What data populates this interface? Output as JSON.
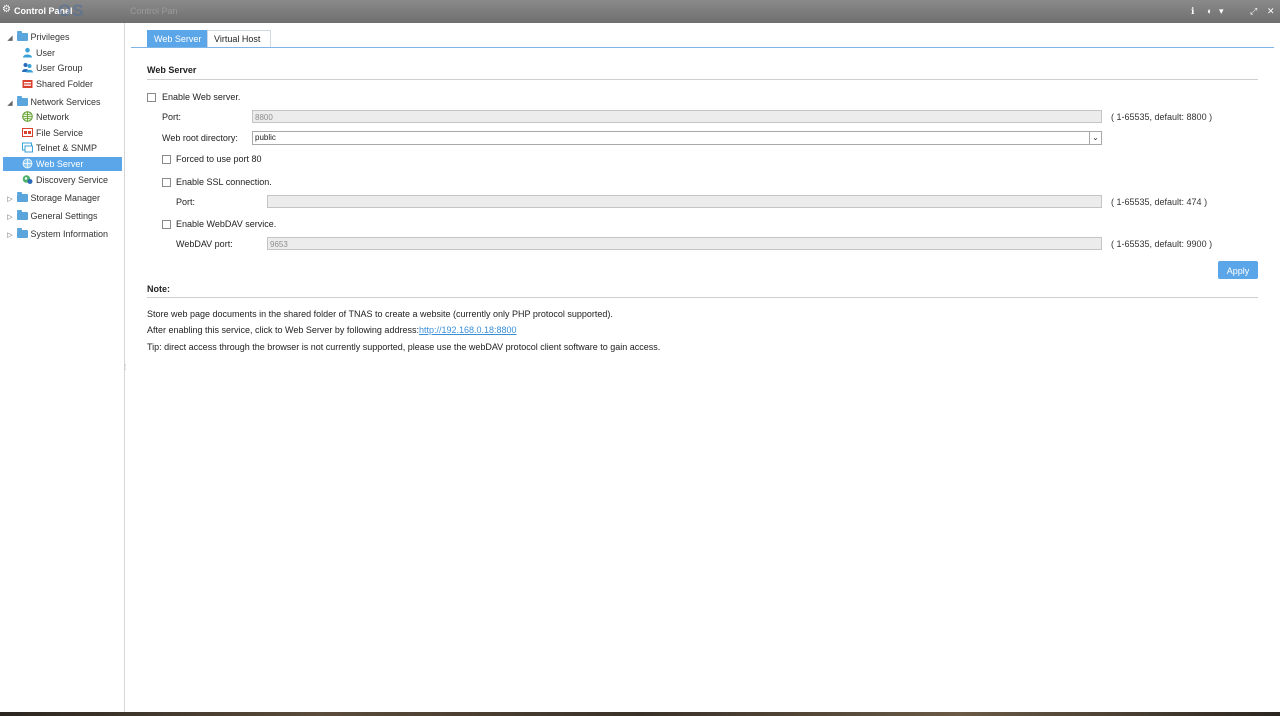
{
  "window": {
    "title": "Control Panel",
    "ghost_logo": "OS",
    "ghost_tab": "Control Pan",
    "controls": [
      "ℹ",
      "◐",
      "▾",
      "⤢",
      "✕"
    ]
  },
  "sidebar": {
    "groups": [
      {
        "label": "Privileges",
        "expanded": true,
        "items": [
          {
            "label": "User",
            "icon": "user-icon"
          },
          {
            "label": "User Group",
            "icon": "user-group-icon"
          },
          {
            "label": "Shared Folder",
            "icon": "shared-folder-icon"
          }
        ]
      },
      {
        "label": "Network Services",
        "expanded": true,
        "items": [
          {
            "label": "Network",
            "icon": "globe-icon"
          },
          {
            "label": "File Service",
            "icon": "file-service-icon"
          },
          {
            "label": "Telnet & SNMP",
            "icon": "terminal-icon"
          },
          {
            "label": "Web Server",
            "icon": "web-server-icon",
            "selected": true
          },
          {
            "label": "Discovery Service",
            "icon": "discovery-icon"
          }
        ]
      },
      {
        "label": "Storage Manager",
        "expanded": false
      },
      {
        "label": "General Settings",
        "expanded": false
      },
      {
        "label": "System Information",
        "expanded": false
      }
    ]
  },
  "tabs": [
    {
      "label": "Web Server",
      "active": true
    },
    {
      "label": "Virtual Host",
      "active": false
    }
  ],
  "web_server": {
    "section_title": "Web Server",
    "enable_label": "Enable Web server.",
    "port_label": "Port:",
    "port_value": "8800",
    "port_hint": "( 1-65535, default: 8800 )",
    "root_label": "Web root directory:",
    "root_value": "public",
    "forced_label": "Forced to use port 80",
    "ssl_label": "Enable SSL connection.",
    "ssl_port_label": "Port:",
    "ssl_port_value": "",
    "ssl_port_hint": "( 1-65535, default: 474 )",
    "webdav_label": "Enable WebDAV service.",
    "webdav_port_label": "WebDAV port:",
    "webdav_port_value": "9653",
    "webdav_port_hint": "( 1-65535, default: 9900 )",
    "apply_label": "Apply"
  },
  "note": {
    "title": "Note:",
    "line1": "Store web page documents in the shared folder of TNAS to create a website (currently only PHP protocol supported).",
    "line2_prefix": "After enabling this service, click to Web Server by following address:",
    "line2_link": "http://192.168.0.18:8800",
    "line3": "Tip: direct access through the browser is not currently supported, please use the webDAV protocol client software to gain access."
  },
  "colors": {
    "accent": "#5ba6e8",
    "titlebar": "#7a7a7a",
    "link": "#3a8fd8"
  }
}
